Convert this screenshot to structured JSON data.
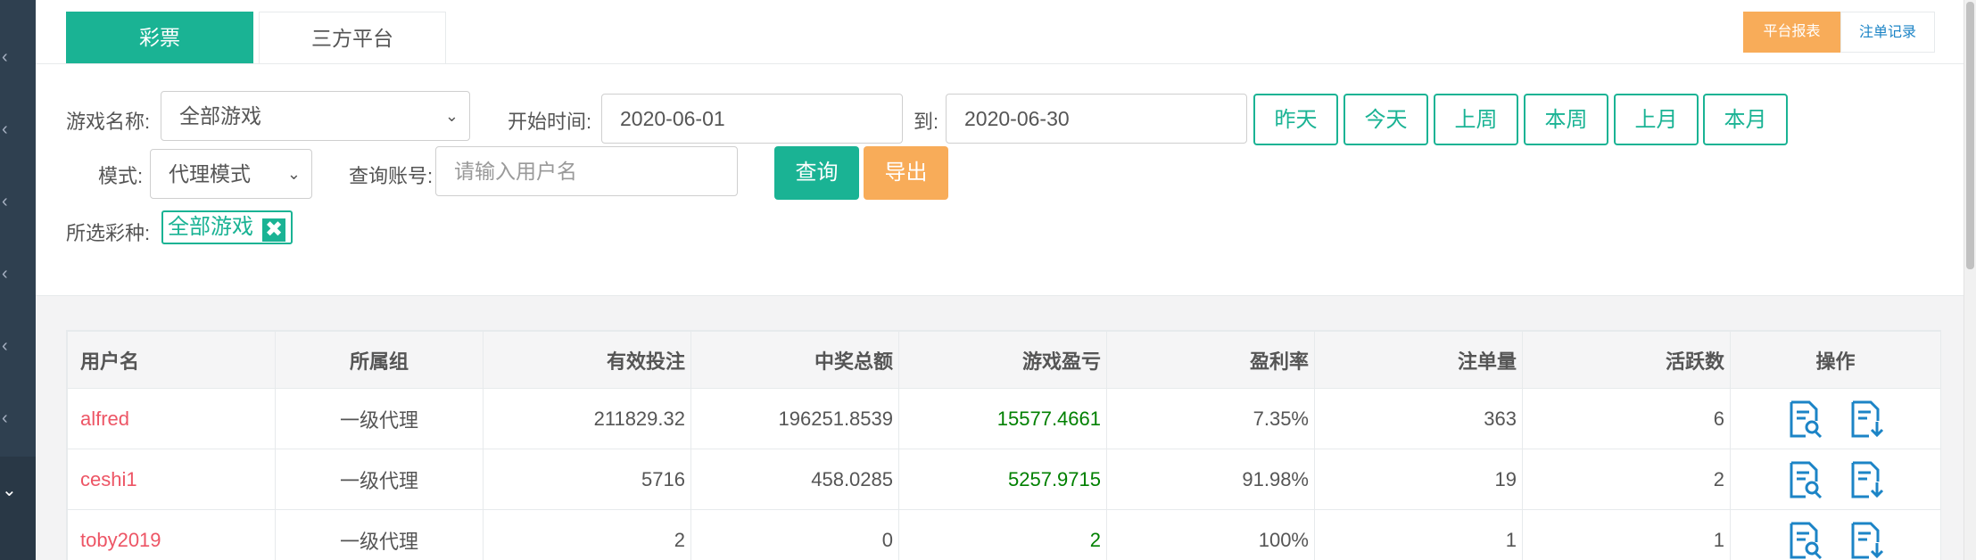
{
  "tabs": [
    {
      "label": "彩票",
      "active": true
    },
    {
      "label": "三方平台",
      "active": false
    }
  ],
  "top_buttons": {
    "platform_report": "平台报表",
    "bet_records": "注单记录"
  },
  "filters": {
    "game_name_label": "游戏名称:",
    "game_name_value": "全部游戏",
    "start_time_label": "开始时间:",
    "start_date": "2020-06-01",
    "to_label": "到:",
    "end_date": "2020-06-30",
    "quick_ranges": [
      "昨天",
      "今天",
      "上周",
      "本周",
      "上月",
      "本月"
    ],
    "mode_label": "模式:",
    "mode_value": "代理模式",
    "account_label": "查询账号:",
    "account_placeholder": "请输入用户名",
    "search_button": "查询",
    "export_button": "导出",
    "selected_label": "所选彩种:",
    "selected_tag": "全部游戏",
    "selected_tag_remove": "✖"
  },
  "table": {
    "headers": [
      "用户名",
      "所属组",
      "有效投注",
      "中奖总额",
      "游戏盈亏",
      "盈利率",
      "注单量",
      "活跃数",
      "操作"
    ],
    "rows": [
      {
        "username": "alfred",
        "group": "一级代理",
        "valid_bet": "211829.32",
        "total_win": "196251.8539",
        "profit": "15577.4661",
        "profit_rate": "7.35%",
        "orders": "363",
        "active": "6"
      },
      {
        "username": "ceshi1",
        "group": "一级代理",
        "valid_bet": "5716",
        "total_win": "458.0285",
        "profit": "5257.9715",
        "profit_rate": "91.98%",
        "orders": "19",
        "active": "2"
      },
      {
        "username": "toby2019",
        "group": "一级代理",
        "valid_bet": "2",
        "total_win": "0",
        "profit": "2",
        "profit_rate": "100%",
        "orders": "1",
        "active": "1"
      }
    ]
  },
  "icons": {
    "row_actions": [
      "report-search-icon",
      "report-export-icon"
    ]
  },
  "colors": {
    "primary": "#1ab394",
    "warning": "#f8ac59",
    "username": "#ed5565",
    "profit": "#008000",
    "link": "#1c84c6",
    "sidebar": "#2f4050"
  }
}
